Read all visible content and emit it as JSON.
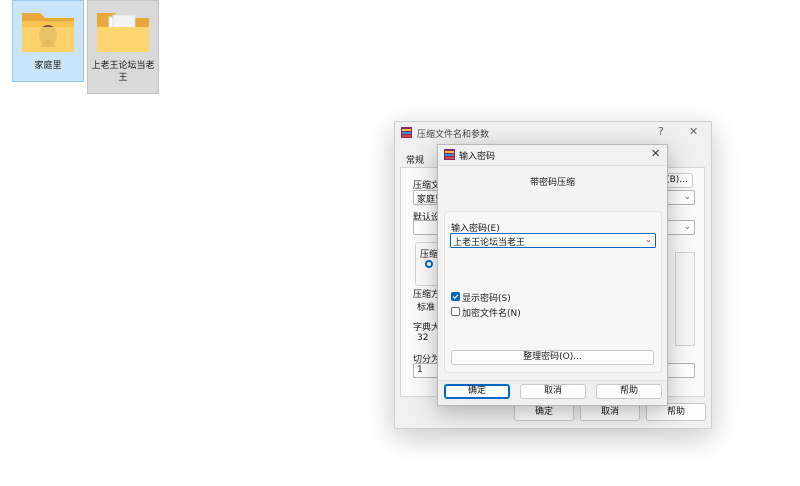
{
  "desktop": {
    "icons": [
      {
        "label": "家庭里"
      },
      {
        "label": "上老王论坛当老王"
      }
    ]
  },
  "bg_dialog": {
    "title": "压缩文件名和参数",
    "help_glyph": "?",
    "close_glyph": "✕",
    "tab_general": "常规",
    "archive_name_label": "压缩文",
    "archive_name_value": "家庭里",
    "browse_button": "(B)...",
    "default_settings_label": "默认设",
    "format_label": "压缩",
    "method_label": "压缩方",
    "method_value": "标准",
    "dict_label": "字典大",
    "dict_value": "32",
    "split_label": "切分为",
    "split_value": "1",
    "ok_button": "确定",
    "cancel_button": "取消",
    "help_button": "帮助"
  },
  "pwd_dialog": {
    "title": "输入密码",
    "close_glyph": "✕",
    "heading": "带密码压缩",
    "enter_label": "输入密码(E)",
    "password_value": "上老王论坛当老王",
    "show_password_label": "显示密码(S)",
    "show_password_checked": true,
    "encrypt_names_label": "加密文件名(N)",
    "encrypt_names_checked": false,
    "organize_button": "整理密码(O)...",
    "ok_button": "确定",
    "cancel_button": "取消",
    "help_button": "帮助"
  },
  "colors": {
    "accent": "#0067c0",
    "folder": "#f8c44f"
  }
}
